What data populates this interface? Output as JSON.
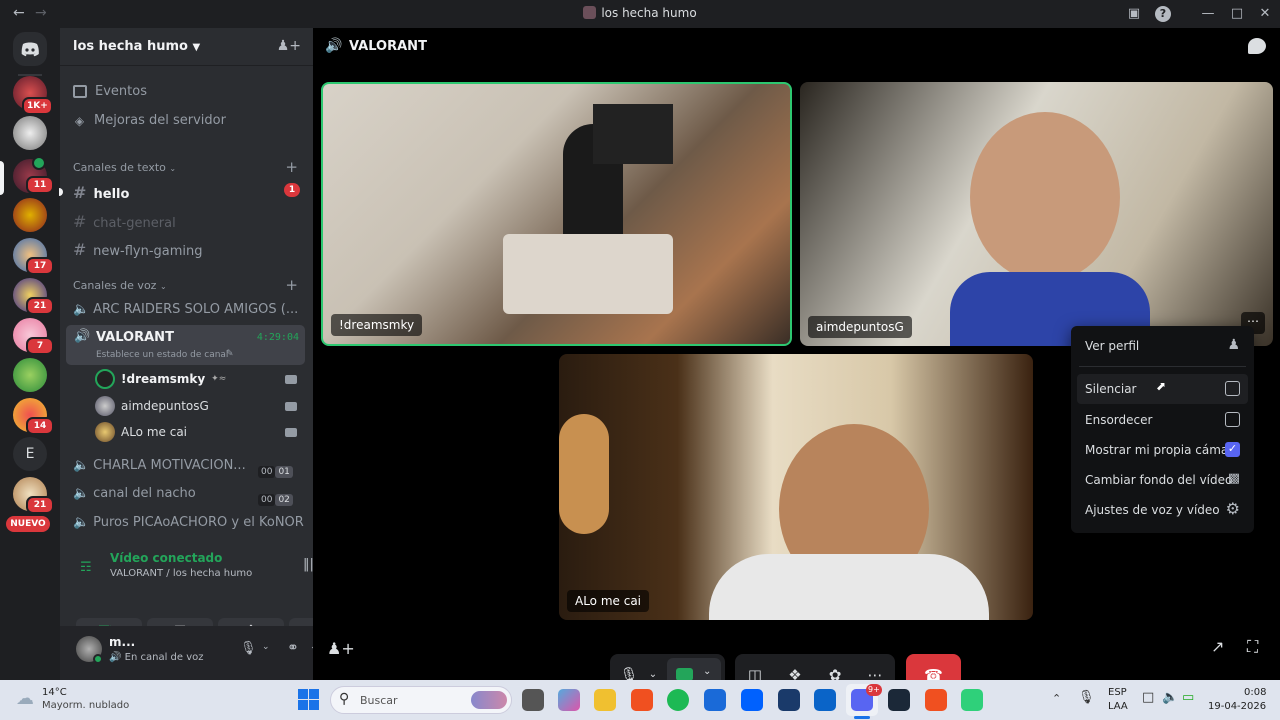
{
  "window": {
    "title": "los hecha humo"
  },
  "server_badges": [
    "1K+",
    "11",
    "17",
    "21",
    "7",
    "14",
    "21"
  ],
  "server_letter": "E",
  "server_new": "NUEVO",
  "guild": {
    "name": "los hecha humo",
    "events_label": "Eventos",
    "boost_label": "Mejoras del servidor"
  },
  "text_category": "Canales de texto",
  "text_channels": [
    {
      "name": "hello",
      "badge": "1"
    },
    {
      "name": "chat-general"
    },
    {
      "name": "new-flyn-gaming"
    }
  ],
  "voice_category": "Canales de voz",
  "voice_channels": {
    "arc": "ARC RAIDERS SOLO AMIGOS (...",
    "valorant": "VALORANT",
    "valorant_time": "4:29:04",
    "valorant_status": "Establece un estado de canal",
    "charla": "CHARLA MOTIVACION...",
    "charla_counts": [
      "00",
      "01"
    ],
    "nacho": "canal del nacho",
    "nacho_counts": [
      "00",
      "02"
    ],
    "puros": "Puros PICAoACHORO y el KoNOR"
  },
  "voice_users": [
    "!dreamsmky",
    "aimdepuntosG",
    "ALo me cai"
  ],
  "voice_connection": {
    "status": "Vídeo conectado",
    "location": "VALORANT / los hecha humo"
  },
  "user": {
    "name": "m...",
    "status": "En canal de voz"
  },
  "main_header": {
    "channel": "VALORANT"
  },
  "tiles": [
    {
      "label": "!dreamsmky"
    },
    {
      "label": "aimdepuntosG"
    },
    {
      "label": "ALo me cai"
    }
  ],
  "context_menu": {
    "view_profile": "Ver perfil",
    "mute": "Silenciar",
    "deafen": "Ensordecer",
    "show_own_camera": "Mostrar mi propia cámara",
    "change_background": "Cambiar fondo del vídeo",
    "voice_video_settings": "Ajustes de voz y vídeo"
  },
  "taskbar": {
    "weather_temp": "14°C",
    "weather_desc": "Mayorm. nublado",
    "search_placeholder": "Buscar",
    "lang1": "ESP",
    "lang2": "LAA",
    "time": "0:08",
    "date": "19-04-2026",
    "discord_badge": "9+"
  },
  "colors": {
    "accent": "#5865f2",
    "green": "#23a55a",
    "red": "#da373c",
    "speaking": "#2dc770"
  }
}
